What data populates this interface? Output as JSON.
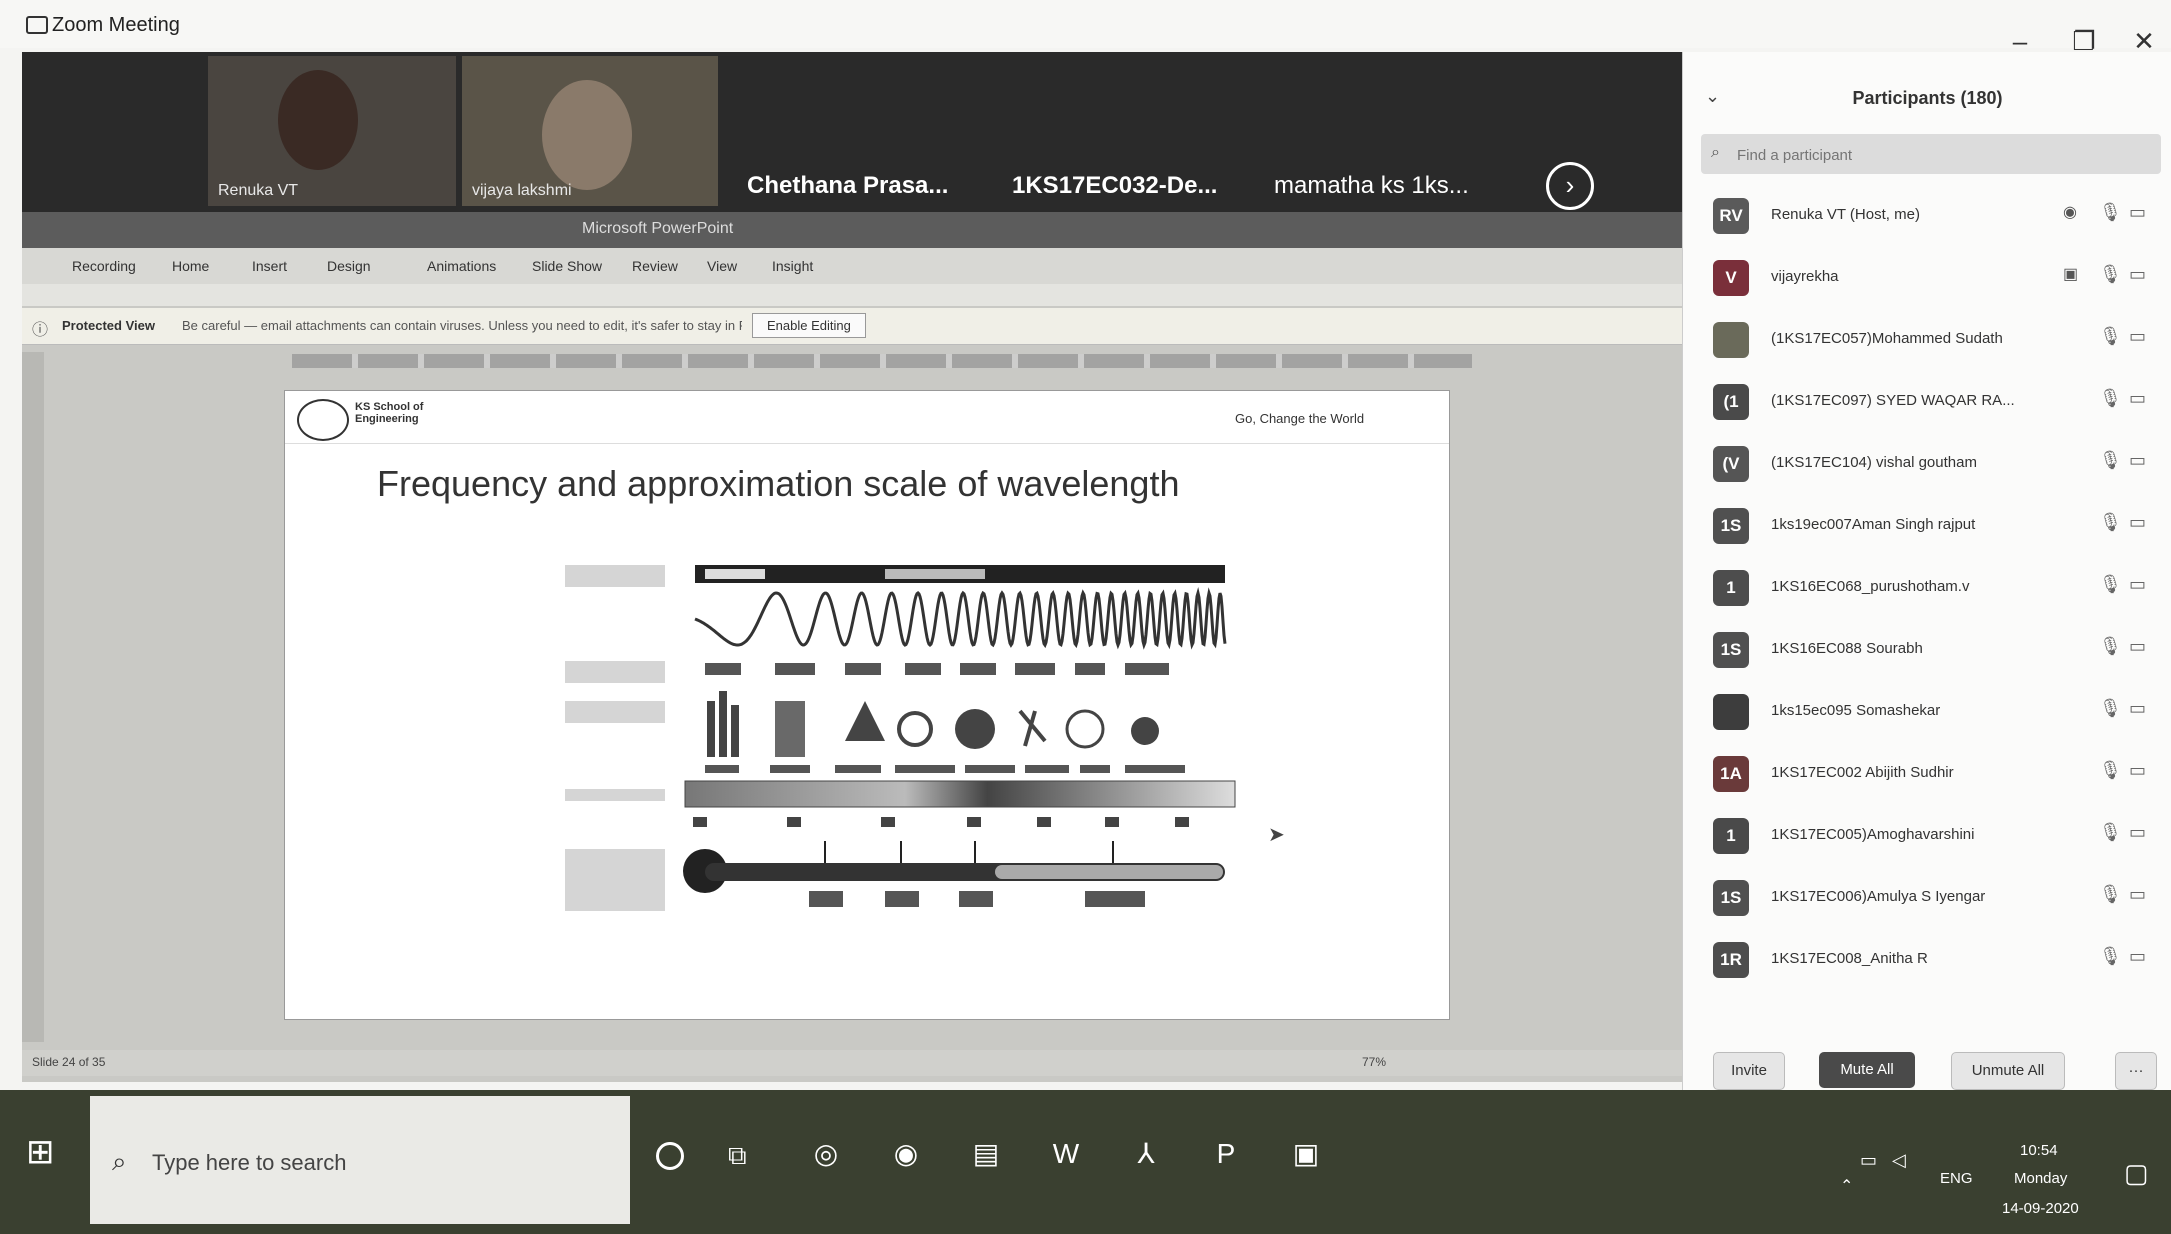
{
  "window": {
    "title": "Zoom Meeting",
    "controls": {
      "minimize": "–",
      "restore": "❐",
      "close": "✕"
    }
  },
  "gallery": {
    "tiles": [
      {
        "name": "Renuka VT"
      },
      {
        "name": "vijaya lakshmi"
      }
    ],
    "name_tiles": [
      {
        "name": "Chethana Prasa..."
      },
      {
        "name": "1KS17EC032-De..."
      },
      {
        "name": "mamatha ks 1ks..."
      }
    ],
    "next_icon": "chevron-right-icon"
  },
  "shared_screen": {
    "ppt": {
      "title_text": "Microsoft PowerPoint",
      "tabs": [
        "Recording",
        "Home",
        "Insert",
        "Design",
        "Animations",
        "Slide Show",
        "Review",
        "View",
        "Insight"
      ],
      "protected_label": "Protected View",
      "protected_msg": "Be careful — email attachments can contain viruses. Unless you need to edit, it's safer to stay in Protected View.",
      "enable_editing": "Enable Editing",
      "status_text": "Slide 24 of 35",
      "zoom": "77%"
    },
    "slide": {
      "logo_text": "KS School of Engineering",
      "tagline": "Go, Change the World",
      "title": "Frequency and approximation scale  of wavelength"
    }
  },
  "participants": {
    "title": "Participants (180)",
    "search_placeholder": "Find a participant",
    "list": [
      {
        "initials": "RV",
        "name": "Renuka VT (Host, me)",
        "color": "#5a5a5a",
        "extra": "◉"
      },
      {
        "initials": "V",
        "name": "vijayrekha",
        "color": "#7a2f3a",
        "extra": "▣"
      },
      {
        "initials": "",
        "name": "(1KS17EC057)Mohammed Sudath",
        "color": "#6a6a5a",
        "extra": ""
      },
      {
        "initials": "(1",
        "name": "(1KS17EC097) SYED WAQAR RA...",
        "color": "#4a4a4a",
        "extra": ""
      },
      {
        "initials": "(V",
        "name": "(1KS17EC104) vishal goutham",
        "color": "#555555",
        "extra": ""
      },
      {
        "initials": "1S",
        "name": "1ks19ec007Aman Singh rajput",
        "color": "#505050",
        "extra": ""
      },
      {
        "initials": "1",
        "name": "1KS16EC068_purushotham.v",
        "color": "#4d4d4d",
        "extra": ""
      },
      {
        "initials": "1S",
        "name": "1KS16EC088 Sourabh",
        "color": "#505050",
        "extra": ""
      },
      {
        "initials": "",
        "name": "1ks15ec095 Somashekar",
        "color": "#3d3d3d",
        "extra": ""
      },
      {
        "initials": "1A",
        "name": "1KS17EC002 Abijith Sudhir",
        "color": "#6a3a3a",
        "extra": ""
      },
      {
        "initials": "1",
        "name": "1KS17EC005)Amoghavarshini",
        "color": "#4a4a4a",
        "extra": ""
      },
      {
        "initials": "1S",
        "name": "1KS17EC006)Amulya S Iyengar",
        "color": "#505050",
        "extra": ""
      },
      {
        "initials": "1R",
        "name": "1KS17EC008_Anitha R",
        "color": "#4d4d4d",
        "extra": ""
      }
    ],
    "mic_icon": "mic-muted-icon",
    "cam_icon": "video-off-icon",
    "buttons": {
      "invite": "Invite",
      "mute_all": "Mute All",
      "unmute_all": "Unmute All",
      "more": "···"
    }
  },
  "taskbar": {
    "search_placeholder": "Type here to search",
    "lang": "ENG",
    "time": "10:54",
    "day": "Monday",
    "date": "14-09-2020"
  }
}
